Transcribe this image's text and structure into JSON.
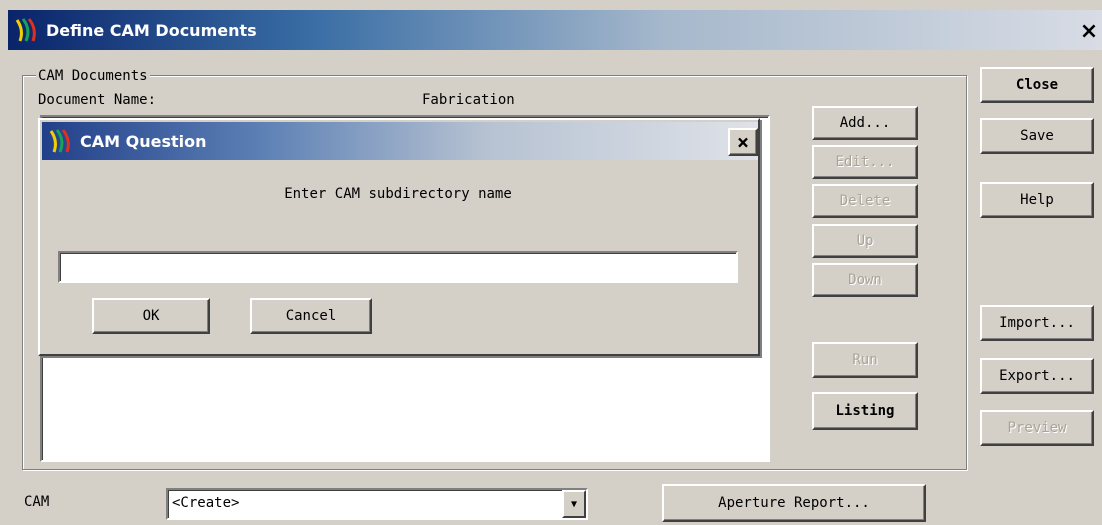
{
  "window": {
    "title": "Define CAM Documents",
    "close_glyph": "×"
  },
  "group": {
    "label": "CAM Documents"
  },
  "list": {
    "column_name": "Document Name:",
    "column_type": "Fabrication",
    "items": []
  },
  "side_buttons": {
    "add": "Add...",
    "edit": "Edit...",
    "delete": "Delete",
    "up": "Up",
    "down": "Down",
    "run": "Run",
    "listing": "Listing"
  },
  "right_buttons": {
    "close": "Close",
    "save": "Save",
    "help": "Help",
    "import": "Import...",
    "export": "Export...",
    "preview": "Preview"
  },
  "bottom": {
    "cam_label": "CAM",
    "cam_selected": "<Create>",
    "aperture_button": "Aperture Report..."
  },
  "dialog": {
    "title": "CAM Question",
    "close_glyph": "×",
    "prompt": "Enter CAM subdirectory name",
    "input_value": "",
    "ok": "OK",
    "cancel": "Cancel"
  },
  "colors": {
    "face": "#d4d0c8",
    "title_active": "#0a246a",
    "disabled_text": "#a8a498"
  }
}
